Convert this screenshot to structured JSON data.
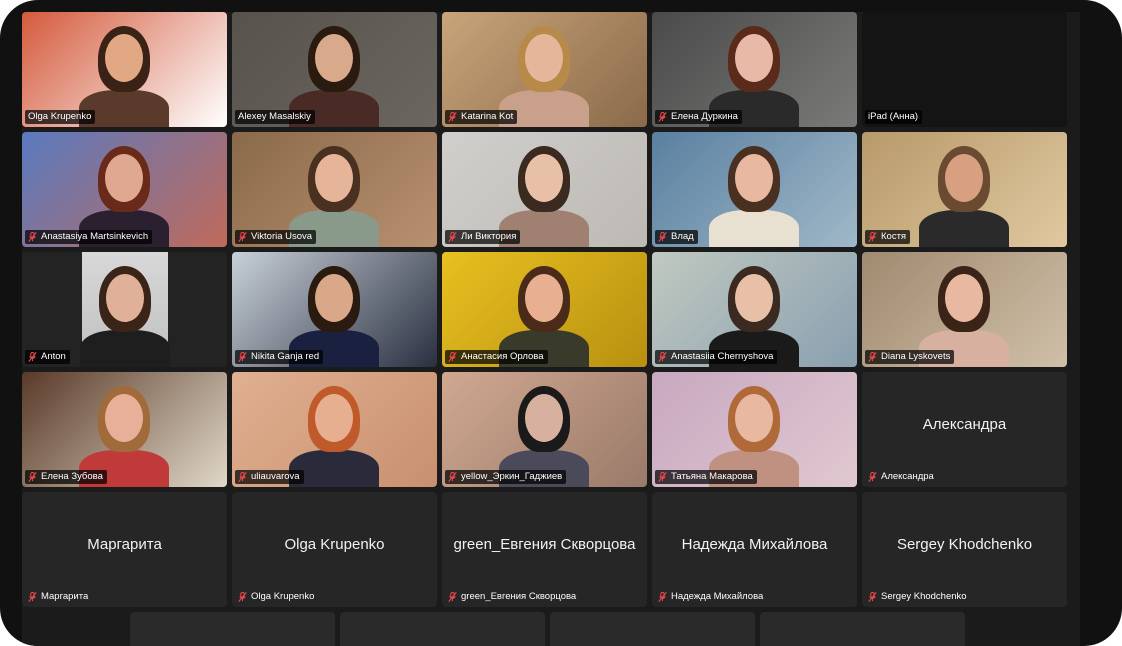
{
  "participants": [
    {
      "name": "Olga Krupenko",
      "muted": false,
      "video": true,
      "active": false,
      "bg": "#d45a3c",
      "bg2": "#ffffff",
      "skin": "#e2a884",
      "hair": "#3a2216",
      "shirt": "#5a3a2a"
    },
    {
      "name": "Alexey Masalskiy",
      "muted": false,
      "video": true,
      "active": true,
      "bg": "#58524c",
      "bg2": "#6c6660",
      "skin": "#d9a98c",
      "hair": "#2a1a10",
      "shirt": "#4a2a24"
    },
    {
      "name": "Katarina Kot",
      "muted": true,
      "video": true,
      "active": false,
      "bg": "#c9a47a",
      "bg2": "#8a6a4a",
      "skin": "#e6b69a",
      "hair": "#b88a4a",
      "shirt": "#c9a08a"
    },
    {
      "name": "Елена Дуркина",
      "muted": true,
      "video": true,
      "active": false,
      "bg": "#4a4a4a",
      "bg2": "#7a7a78",
      "skin": "#e7b9a6",
      "hair": "#5a2a1a",
      "shirt": "#2a2a2a"
    },
    {
      "name": "iPad (Анна)",
      "muted": false,
      "video": true,
      "active": false,
      "bg": "#141414",
      "bg2": "#141414",
      "skin": "",
      "hair": "",
      "shirt": "",
      "empty": true
    },
    {
      "name": "Anastasiya Martsinkevich",
      "muted": true,
      "video": true,
      "active": false,
      "bg": "#5a7ac0",
      "bg2": "#c06a5a",
      "skin": "#e0a890",
      "hair": "#6a2a1a",
      "shirt": "#2a2030"
    },
    {
      "name": "Viktoria Usova",
      "muted": true,
      "video": true,
      "active": false,
      "bg": "#8a6a4a",
      "bg2": "#b89070",
      "skin": "#e6b498",
      "hair": "#4a3020",
      "shirt": "#8a9a8a"
    },
    {
      "name": "Ли Виктория",
      "muted": true,
      "video": true,
      "active": false,
      "bg": "#d0cfcc",
      "bg2": "#bdb9b4",
      "skin": "#e8c0a8",
      "hair": "#3a2a20",
      "shirt": "#a08070"
    },
    {
      "name": "Влад",
      "muted": true,
      "video": true,
      "active": false,
      "bg": "#5a80a0",
      "bg2": "#a0b8c8",
      "skin": "#e8b8a0",
      "hair": "#4a3020",
      "shirt": "#e8e0d0"
    },
    {
      "name": "Костя",
      "muted": true,
      "video": true,
      "active": false,
      "bg": "#b89a6a",
      "bg2": "#e0c8a0",
      "skin": "#d8a080",
      "hair": "#6a4a30",
      "shirt": "#2a2a2a"
    },
    {
      "name": "Anton",
      "muted": true,
      "video": true,
      "active": false,
      "bg": "#232323",
      "bg2": "#d8d8d8",
      "skin": "#e0b098",
      "hair": "#3a2418",
      "shirt": "#1e1e1e",
      "narrow": true
    },
    {
      "name": "Nikita Ganja red",
      "muted": true,
      "video": true,
      "active": false,
      "bg": "#c8d0d8",
      "bg2": "#2a3040",
      "skin": "#d8a888",
      "hair": "#2a1a10",
      "shirt": "#1a2040"
    },
    {
      "name": "Анастасия Орлова",
      "muted": true,
      "video": true,
      "active": false,
      "bg": "#e8c020",
      "bg2": "#b89010",
      "skin": "#e8b090",
      "hair": "#4a2a18",
      "shirt": "#3a3a2a"
    },
    {
      "name": "Anastasiia Chernyshova",
      "muted": true,
      "video": true,
      "active": false,
      "bg": "#c0c8c0",
      "bg2": "#8aa0b0",
      "skin": "#e8c0a8",
      "hair": "#3a2a20",
      "shirt": "#1a1a1a"
    },
    {
      "name": "Diana Lyskovets",
      "muted": true,
      "video": true,
      "active": false,
      "bg": "#a08a70",
      "bg2": "#d0c0a8",
      "skin": "#e8b8a0",
      "hair": "#3a2418",
      "shirt": "#d8b0a0"
    },
    {
      "name": "Елена Зубова",
      "muted": true,
      "video": true,
      "active": false,
      "bg": "#5a3a28",
      "bg2": "#e0d8c8",
      "skin": "#e8b098",
      "hair": "#a06a3a",
      "shirt": "#c03a3a"
    },
    {
      "name": "uliauvarova",
      "muted": true,
      "video": true,
      "active": false,
      "bg": "#e0b090",
      "bg2": "#c89070",
      "skin": "#e6b090",
      "hair": "#c05a2a",
      "shirt": "#2a2a3a"
    },
    {
      "name": "yellow_Эркин_Гаджиев",
      "muted": true,
      "video": true,
      "active": false,
      "bg": "#d0a890",
      "bg2": "#9a7a6a",
      "skin": "#d8b0a0",
      "hair": "#1a1a1a",
      "shirt": "#4a4a5a"
    },
    {
      "name": "Татьяна Макарова",
      "muted": true,
      "video": true,
      "active": false,
      "bg": "#c8a8c0",
      "bg2": "#e0c8d0",
      "skin": "#e8b8a0",
      "hair": "#b06a3a",
      "shirt": "#c09080"
    },
    {
      "name": "Александра",
      "muted": true,
      "video": false,
      "active": false,
      "display": "Александра"
    },
    {
      "name": "Маргарита",
      "muted": true,
      "video": false,
      "active": false,
      "display": "Маргарита"
    },
    {
      "name": "Olga Krupenko",
      "muted": true,
      "video": false,
      "active": false,
      "display": "Olga Krupenko"
    },
    {
      "name": "green_Евгения Скворцова",
      "muted": true,
      "video": false,
      "active": false,
      "display": "green_Евгения Скворцова"
    },
    {
      "name": "Надежда Михайлова",
      "muted": true,
      "video": false,
      "active": false,
      "display": "Надежда Михайлова"
    },
    {
      "name": "Sergey Khodchenko",
      "muted": true,
      "video": false,
      "active": false,
      "display": "Sergey Khodchenko"
    }
  ],
  "colors": {
    "active_border": "#3fb04a",
    "muted_icon": "#e5484d",
    "tile_bg": "#262626"
  }
}
